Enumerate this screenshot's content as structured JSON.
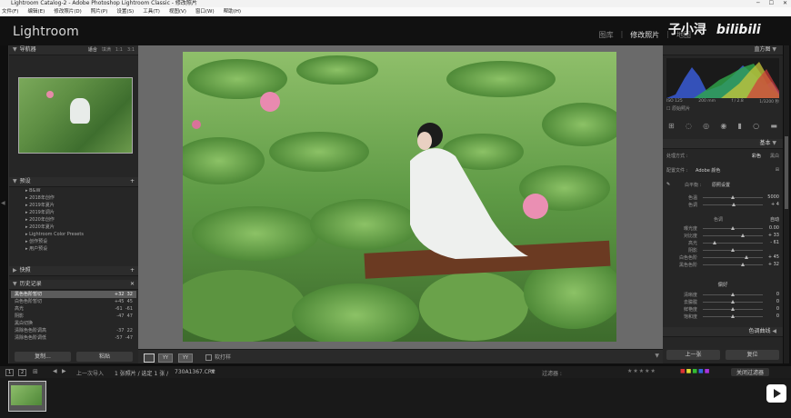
{
  "titlebar": {
    "title": "Lightroom Catalog-2 - Adobe Photoshop Lightroom Classic - 修改照片"
  },
  "menu": [
    "文件(F)",
    "编辑(E)",
    "修改照片(D)",
    "照片(P)",
    "设置(S)",
    "工具(T)",
    "视图(V)",
    "窗口(W)",
    "帮助(H)"
  ],
  "app": {
    "logo": "Lightroom"
  },
  "modules": [
    "图库",
    "修改照片",
    "地图"
  ],
  "watermark": {
    "text": "子小浔",
    "brand": "bilibili"
  },
  "navigator": {
    "title": "导航器",
    "zoom": [
      "适合",
      "填满",
      "1:1",
      "3:1"
    ]
  },
  "presets": {
    "title": "预设",
    "items": [
      "B&W",
      "2018年创作",
      "2019年夏片",
      "2019年调片",
      "2020年创作",
      "2020年夏片",
      "Lightroom Color Presets",
      "创作预设",
      "用户预设"
    ]
  },
  "snapshots": {
    "title": "快照"
  },
  "history": {
    "title": "历史记录",
    "items": [
      {
        "label": "黑色色阶暂切",
        "a": "+32",
        "b": "32"
      },
      {
        "label": "白色色阶暂切",
        "a": "+45",
        "b": "45"
      },
      {
        "label": "高光",
        "a": "-61",
        "b": "-61"
      },
      {
        "label": "阴影",
        "a": "-47",
        "b": "47"
      },
      {
        "label": "黑白切换",
        "a": "",
        "b": ""
      },
      {
        "label": "清除色色阶调高",
        "a": "-37",
        "b": "22"
      },
      {
        "label": "清除色色阶调低",
        "a": "-57",
        "b": "-47"
      }
    ]
  },
  "leftbuttons": {
    "copy": "复制...",
    "paste": "粘贴"
  },
  "histogram": {
    "title": "直方图",
    "iso": "ISO 125",
    "focal": "200 mm",
    "aperture": "f / 2.8",
    "shutter": "1/3200 秒",
    "original": "原始照片"
  },
  "basic": {
    "title": "基本",
    "treatment_label": "处理方式 :",
    "treatment_color": "彩色",
    "treatment_bw": "黑白",
    "profile_label": "配置文件 :",
    "profile_value": "Adobe 颜色",
    "wb_label": "白平衡 :",
    "wb_value": "原照设置",
    "tone_label": "色调",
    "tone_auto": "自动",
    "presence_label": "偏好",
    "sliders_wb": [
      {
        "label": "色温",
        "value": "5000",
        "pos": 0.5
      },
      {
        "label": "色调",
        "value": "+ 4",
        "pos": 0.52
      }
    ],
    "sliders_tone": [
      {
        "label": "曝光度",
        "value": "0.00",
        "pos": 0.5
      },
      {
        "label": "对比度",
        "value": "+ 33",
        "pos": 0.66
      },
      {
        "label": "高光",
        "value": "- 61",
        "pos": 0.2
      },
      {
        "label": "阴影",
        "value": "",
        "pos": 0.5
      },
      {
        "label": "白色色阶",
        "value": "+ 45",
        "pos": 0.72
      },
      {
        "label": "黑色色阶",
        "value": "+ 32",
        "pos": 0.66
      }
    ],
    "sliders_presence": [
      {
        "label": "清晰度",
        "value": "0",
        "pos": 0.5
      },
      {
        "label": "去朦胧",
        "value": "0",
        "pos": 0.5
      },
      {
        "label": "鲜艳度",
        "value": "0",
        "pos": 0.5
      },
      {
        "label": "饱和度",
        "value": "0",
        "pos": 0.5
      }
    ]
  },
  "tonecurve": {
    "title": "色调曲线"
  },
  "rightbuttons": {
    "prev": "上一张",
    "reset": "复位"
  },
  "toolbar": {
    "softproof": "软打样"
  },
  "filmstripbar": {
    "page1": "1",
    "page2": "2",
    "source": "上一次导入",
    "count": "1 张照片 / 选定 1 张 /",
    "filename": "730A1367.CR2",
    "filter_label": "过滤器 :",
    "filter_value": "关闭过滤器"
  },
  "colors": {
    "accent": "#d8d8d8",
    "panel": "#262626",
    "background": "#6a6a6a"
  }
}
